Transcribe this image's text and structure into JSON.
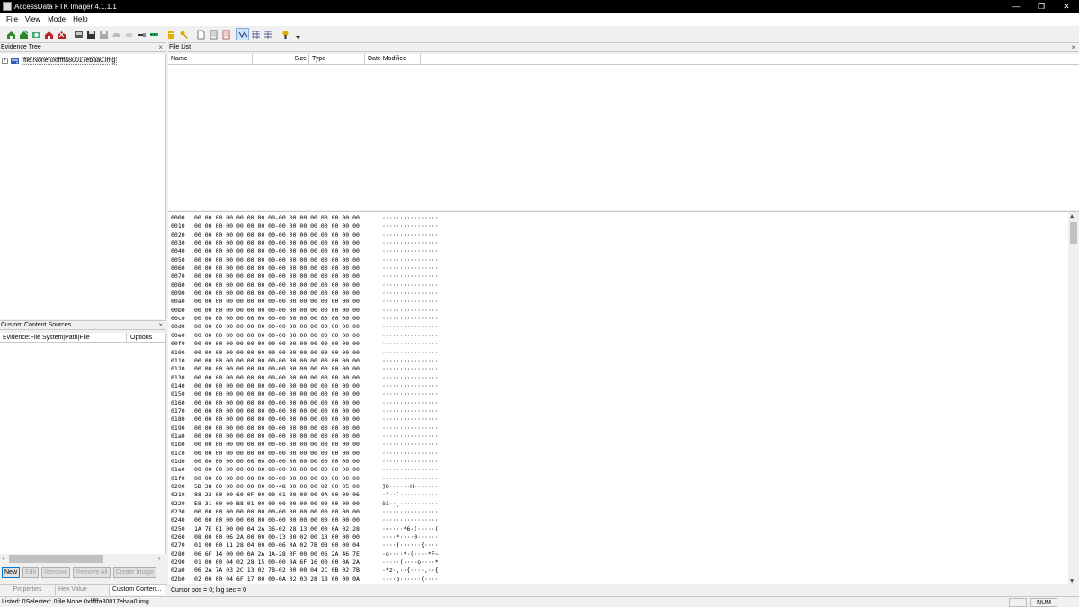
{
  "window": {
    "title": "AccessData FTK Imager 4.1.1.1",
    "minimize": "—",
    "restore": "❐",
    "close": "✕"
  },
  "menu": [
    "File",
    "View",
    "Mode",
    "Help"
  ],
  "evidence_tree": {
    "title": "Evidence Tree",
    "close": "×",
    "items": [
      {
        "expander": "+",
        "label": "file.None.0xfffffa80017ebaa0.img"
      }
    ]
  },
  "file_list": {
    "title": "File List",
    "close": "×",
    "columns": [
      "Name",
      "Size",
      "Type",
      "Date Modified"
    ]
  },
  "custom_content": {
    "title": "Custom Content Sources",
    "close": "×",
    "columns": [
      "Evidence:File System|Path|File",
      "Options"
    ],
    "buttons": [
      "New",
      "Edit",
      "Remove",
      "Remove All",
      "Create Image"
    ]
  },
  "bottom_tabs": [
    "Properties",
    "Hex Value Inter...",
    "Custom Conten..."
  ],
  "hex": {
    "rows": [
      {
        "off": "0000",
        "b": "00 00 00 00 00 00 00 00-00 00 00 00 00 00 00 00",
        "a": "················"
      },
      {
        "off": "0010",
        "b": "00 00 00 00 00 00 00 00-00 00 00 00 00 00 00 00",
        "a": "················"
      },
      {
        "off": "0020",
        "b": "00 00 00 00 00 00 00 00-00 00 00 00 00 00 00 00",
        "a": "················"
      },
      {
        "off": "0030",
        "b": "00 00 00 00 00 00 00 00-00 00 00 00 00 00 00 00",
        "a": "················"
      },
      {
        "off": "0040",
        "b": "00 00 00 00 00 00 00 00-00 00 00 00 00 00 00 00",
        "a": "················"
      },
      {
        "off": "0050",
        "b": "00 00 00 00 00 00 00 00-00 00 00 00 00 00 00 00",
        "a": "················"
      },
      {
        "off": "0060",
        "b": "00 00 00 00 00 00 00 00-00 00 00 00 00 00 00 00",
        "a": "················"
      },
      {
        "off": "0070",
        "b": "00 00 00 00 00 00 00 00-00 00 00 00 00 00 00 00",
        "a": "················"
      },
      {
        "off": "0080",
        "b": "00 00 00 00 00 00 00 00-00 00 00 00 00 00 00 00",
        "a": "················"
      },
      {
        "off": "0090",
        "b": "00 00 00 00 00 00 00 00-00 00 00 00 00 00 00 00",
        "a": "················"
      },
      {
        "off": "00a0",
        "b": "00 00 00 00 00 00 00 00-00 00 00 00 00 00 00 00",
        "a": "················"
      },
      {
        "off": "00b0",
        "b": "00 00 00 00 00 00 00 00-00 00 00 00 00 00 00 00",
        "a": "················"
      },
      {
        "off": "00c0",
        "b": "00 00 00 00 00 00 00 00-00 00 00 00 00 00 00 00",
        "a": "················"
      },
      {
        "off": "00d0",
        "b": "00 00 00 00 00 00 00 00-00 00 00 00 00 00 00 00",
        "a": "················"
      },
      {
        "off": "00e0",
        "b": "00 00 00 00 00 00 00 00-00 00 00 00 00 00 00 00",
        "a": "················"
      },
      {
        "off": "00f0",
        "b": "00 00 00 00 00 00 00 00-00 00 00 00 00 00 00 00",
        "a": "················"
      },
      {
        "off": "0100",
        "b": "00 00 00 00 00 00 00 00-00 00 00 00 00 00 00 00",
        "a": "················"
      },
      {
        "off": "0110",
        "b": "00 00 00 00 00 00 00 00-00 00 00 00 00 00 00 00",
        "a": "················"
      },
      {
        "off": "0120",
        "b": "00 00 00 00 00 00 00 00-00 00 00 00 00 00 00 00",
        "a": "················"
      },
      {
        "off": "0130",
        "b": "00 00 00 00 00 00 00 00-00 00 00 00 00 00 00 00",
        "a": "················"
      },
      {
        "off": "0140",
        "b": "00 00 00 00 00 00 00 00-00 00 00 00 00 00 00 00",
        "a": "················"
      },
      {
        "off": "0150",
        "b": "00 00 00 00 00 00 00 00-00 00 00 00 00 00 00 00",
        "a": "················"
      },
      {
        "off": "0160",
        "b": "00 00 00 00 00 00 00 00-00 00 00 00 00 00 00 00",
        "a": "················"
      },
      {
        "off": "0170",
        "b": "00 00 00 00 00 00 00 00-00 00 00 00 00 00 00 00",
        "a": "················"
      },
      {
        "off": "0180",
        "b": "00 00 00 00 00 00 00 00-00 00 00 00 00 00 00 00",
        "a": "················"
      },
      {
        "off": "0190",
        "b": "00 00 00 00 00 00 00 00-00 00 00 00 00 00 00 00",
        "a": "················"
      },
      {
        "off": "01a0",
        "b": "00 00 00 00 00 00 00 00-00 00 00 00 00 00 00 00",
        "a": "················"
      },
      {
        "off": "01b0",
        "b": "00 00 00 00 00 00 00 00-00 00 00 00 00 00 00 00",
        "a": "················"
      },
      {
        "off": "01c0",
        "b": "00 00 00 00 00 00 00 00-00 00 00 00 00 00 00 00",
        "a": "················"
      },
      {
        "off": "01d0",
        "b": "00 00 00 00 00 00 00 00-00 00 00 00 00 00 00 00",
        "a": "················"
      },
      {
        "off": "01e0",
        "b": "00 00 00 00 00 00 00 00-00 00 00 00 00 00 00 00",
        "a": "················"
      },
      {
        "off": "01f0",
        "b": "00 00 00 00 00 00 00 00-00 00 00 00 00 00 00 00",
        "a": "················"
      },
      {
        "off": "0200",
        "b": "5D 38 00 00 00 00 00 00-48 00 00 00 02 00 05 00",
        "a": "]8······H·······"
      },
      {
        "off": "0210",
        "b": "88 22 00 00 60 0F 00 00-01 00 00 00 0A 00 00 06",
        "a": "·\"··`···········"
      },
      {
        "off": "0220",
        "b": "E8 31 00 00 B8 01 00 00-00 00 00 00 00 00 00 00",
        "a": "è1··¸···········"
      },
      {
        "off": "0230",
        "b": "00 00 00 00 00 00 00 00-00 00 00 00 00 00 00 00",
        "a": "················"
      },
      {
        "off": "0240",
        "b": "00 00 00 00 00 00 00 00-00 00 00 00 00 00 00 00",
        "a": "················"
      },
      {
        "off": "0250",
        "b": "1A 7E 01 00 00 04 2A 36-02 28 13 00 00 0A 02 28",
        "a": "·~····*6·(·····("
      },
      {
        "off": "0260",
        "b": "08 00 00 06 2A 00 00 00-13 30 02 00 13 00 00 00",
        "a": "····*····0······"
      },
      {
        "off": "0270",
        "b": "01 00 00 11 28 04 00 00-06 0A 02 7B 03 00 00 04",
        "a": "····(······{····"
      },
      {
        "off": "0280",
        "b": "06 6F 14 00 00 0A 2A 1A-28 0F 00 00 06 2A 46 7E",
        "a": "·o····*·(····*F~"
      },
      {
        "off": "0290",
        "b": "01 00 00 04 02 28 15 00-00 0A 6F 16 00 00 0A 2A",
        "a": "·····(····o····*"
      },
      {
        "off": "02a0",
        "b": "06 2A 7A 03 2C 13 02 7B-02 00 00 04 2C 0B 02 7B",
        "a": "·*z·,··{····,··{"
      },
      {
        "off": "02b0",
        "b": "02 00 00 04 6F 17 00 00-0A 02 03 28 18 00 00 0A",
        "a": "····o······(····"
      }
    ]
  },
  "cursor_status": "Cursor pos = 0; log sec = 0",
  "status": {
    "text": "Listed: 0Selected: 0file.None.0xfffffa80017ebaa0.img",
    "num": "NUM"
  }
}
